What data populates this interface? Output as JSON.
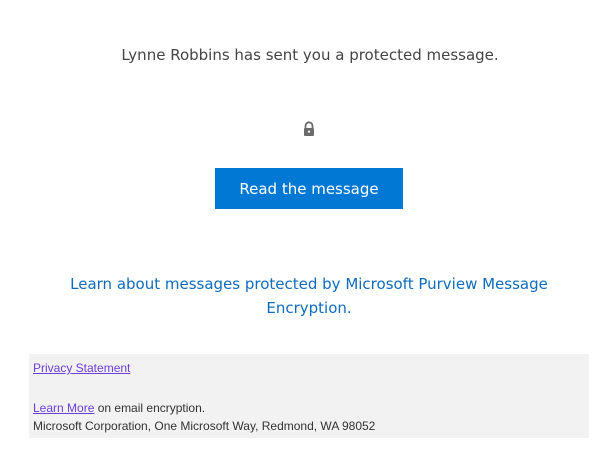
{
  "message": {
    "headline": "Lynne Robbins has sent you a protected message.",
    "lock_icon": "lock-icon",
    "read_button_label": "Read the message",
    "learn_about_link": "Learn about messages protected by Microsoft Purview Message Encryption."
  },
  "footer": {
    "privacy_link": "Privacy Statement",
    "learn_more_link": "Learn More",
    "learn_more_suffix": " on email encryption.",
    "address": "Microsoft Corporation, One Microsoft Way, Redmond, WA 98052"
  },
  "colors": {
    "button_blue": "#0078d4",
    "link_blue": "#0f6cbd",
    "footer_link_purple": "#6b3fd9",
    "footer_background": "#f2f2f2"
  }
}
